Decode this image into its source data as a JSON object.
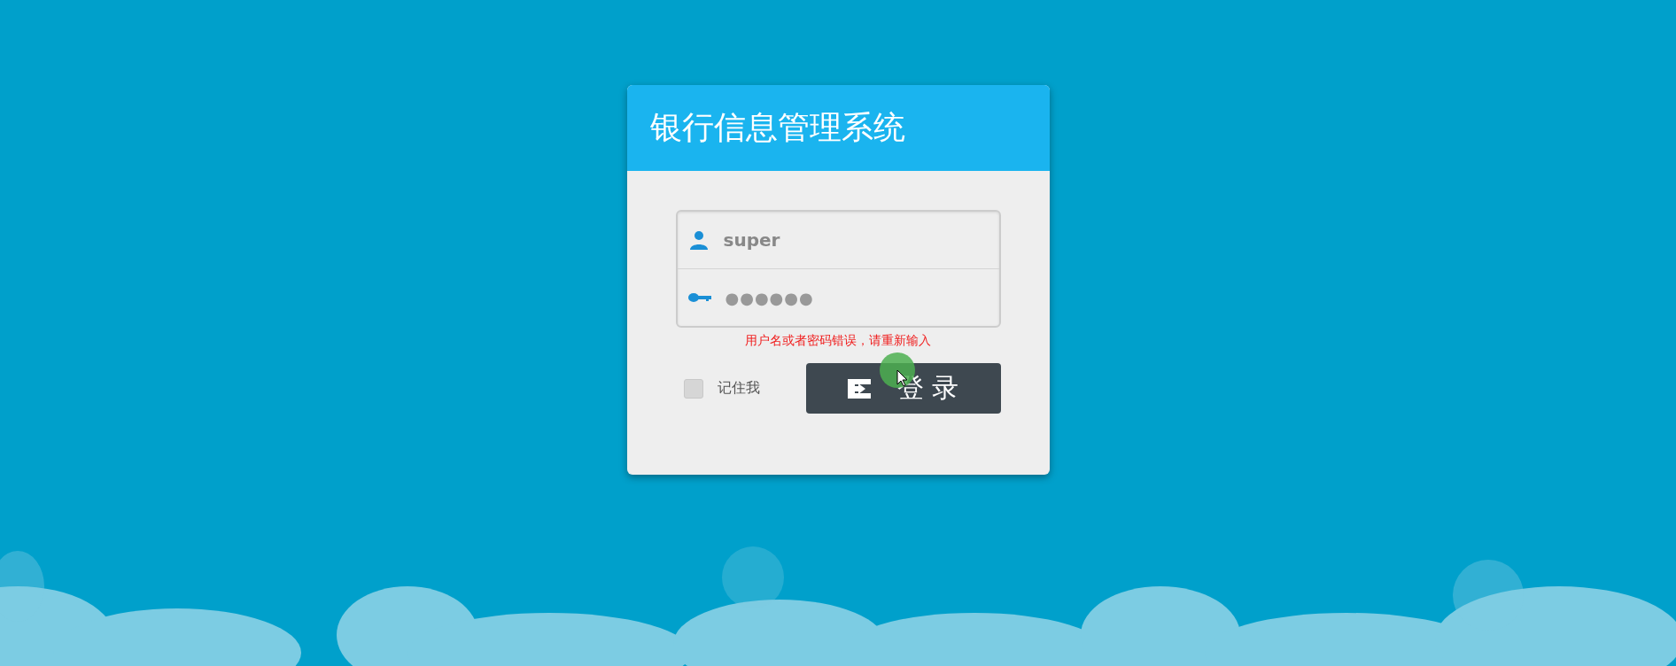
{
  "login_card": {
    "title": "银行信息管理系统",
    "username": {
      "value": "super"
    },
    "password": {
      "value": "●●●●●●"
    },
    "error_message": "用户名或者密码错误，请重新输入",
    "remember_me": {
      "label": "记住我",
      "checked": false
    },
    "login_button": {
      "label": "登 录"
    }
  }
}
